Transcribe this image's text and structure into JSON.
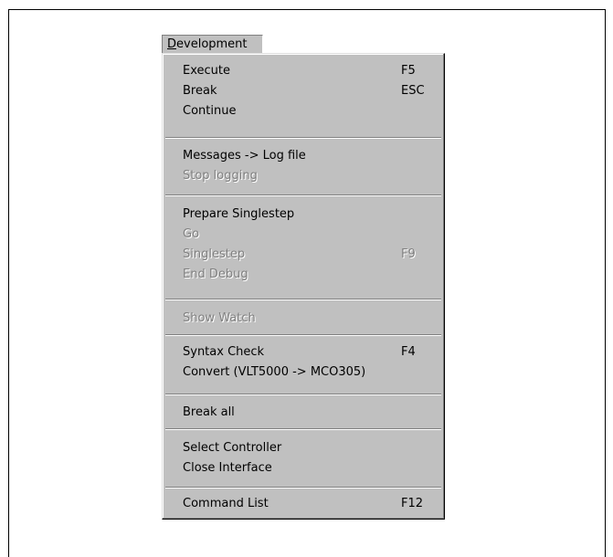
{
  "menu_title": "Development",
  "items": [
    {
      "label": "Execute",
      "shortcut": "F5",
      "enabled": true
    },
    {
      "label": "Break",
      "shortcut": "ESC",
      "enabled": true
    },
    {
      "label": "Continue",
      "shortcut": "",
      "enabled": true
    },
    {
      "label": "Messages -> Log file",
      "shortcut": "",
      "enabled": true
    },
    {
      "label": "Stop logging",
      "shortcut": "",
      "enabled": false
    },
    {
      "label": "Prepare Singlestep",
      "shortcut": "",
      "enabled": true
    },
    {
      "label": "Go",
      "shortcut": "",
      "enabled": false
    },
    {
      "label": "Singlestep",
      "shortcut": "F9",
      "enabled": false
    },
    {
      "label": "End Debug",
      "shortcut": "",
      "enabled": false
    },
    {
      "label": "Show Watch",
      "shortcut": "",
      "enabled": false
    },
    {
      "label": "Syntax Check",
      "shortcut": "F4",
      "enabled": true
    },
    {
      "label": "Convert (VLT5000 -> MCO305)",
      "shortcut": "",
      "enabled": true
    },
    {
      "label": "Break all",
      "shortcut": "",
      "enabled": true
    },
    {
      "label": "Select Controller",
      "shortcut": "",
      "enabled": true
    },
    {
      "label": "Close Interface",
      "shortcut": "",
      "enabled": true
    },
    {
      "label": "Command List",
      "shortcut": "F12",
      "enabled": true
    }
  ]
}
